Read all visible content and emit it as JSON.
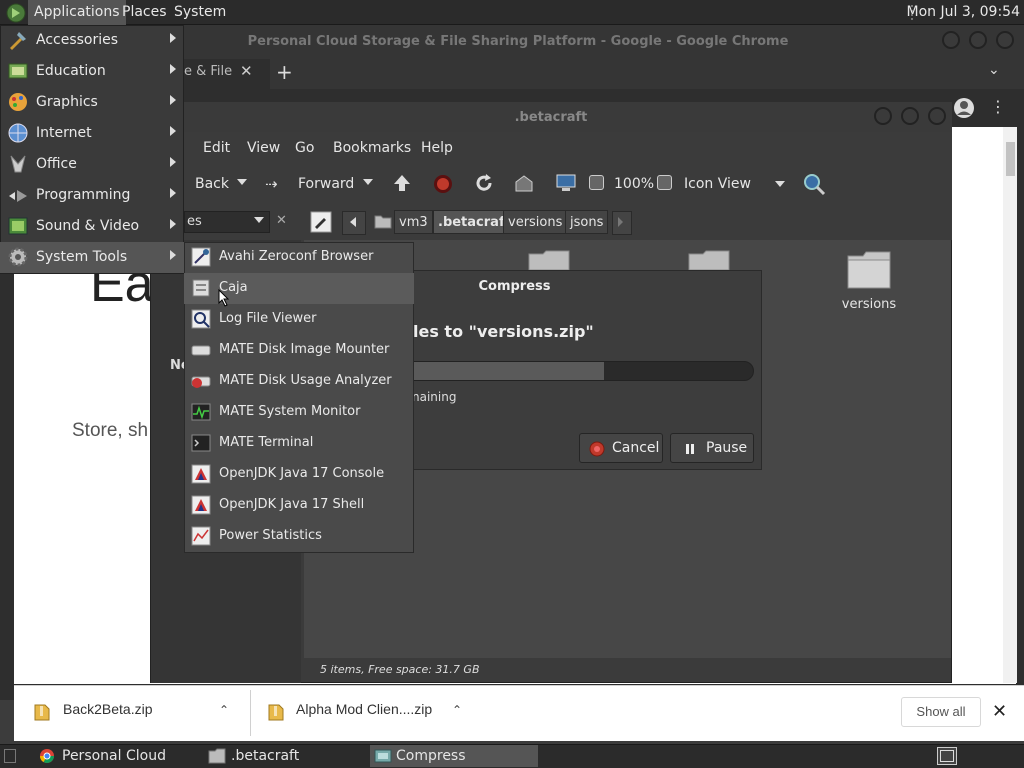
{
  "panel": {
    "menus": [
      "Applications",
      "Places",
      "System"
    ],
    "clock": "Mon Jul 3, 09:54"
  },
  "chrome": {
    "title": "Personal Cloud Storage & File Sharing Platform - Google - Google Chrome",
    "tab_title_fragment": "e & File",
    "page_hero_fragment": "Ea",
    "page_sub_fragment": "Store, sh",
    "downloads": [
      {
        "name": "Back2Beta.zip",
        "icon": "zip-file-icon"
      },
      {
        "name": "Alpha Mod Clien....zip",
        "icon": "zip-file-icon"
      }
    ],
    "show_all_label": "Show all"
  },
  "caja": {
    "title": ".betacraft",
    "menus": [
      "Edit",
      "View",
      "Go",
      "Bookmarks",
      "Help"
    ],
    "toolbar": {
      "back": "Back",
      "forward": "Forward",
      "zoom": "100%",
      "view_mode": "Icon View"
    },
    "sidebar_combo_fragment": "es",
    "sidebar_heading_fragment": "Ne",
    "breadcrumbs": [
      "vm3",
      ".betacraft",
      "versions",
      "jsons"
    ],
    "folders": [
      {
        "name": "",
        "icon": "folder-icon"
      },
      {
        "name": "",
        "icon": "folder-icon"
      },
      {
        "name": "versions",
        "icon": "folder-icon"
      }
    ],
    "status": "5 items, Free space: 31.7 GB"
  },
  "compress": {
    "title": "Compress",
    "heading_fragment": "les to \"versions.zip\"",
    "remaining_fragment": "naining",
    "progress": 0.6,
    "cancel_label": "Cancel",
    "pause_label": "Pause"
  },
  "apps_menu": [
    {
      "label": "Accessories",
      "icon": "accessories-icon"
    },
    {
      "label": "Education",
      "icon": "education-icon"
    },
    {
      "label": "Graphics",
      "icon": "graphics-icon"
    },
    {
      "label": "Internet",
      "icon": "internet-icon"
    },
    {
      "label": "Office",
      "icon": "office-icon"
    },
    {
      "label": "Programming",
      "icon": "programming-icon"
    },
    {
      "label": "Sound & Video",
      "icon": "sound-video-icon"
    },
    {
      "label": "System Tools",
      "icon": "system-tools-icon"
    }
  ],
  "system_tools": [
    {
      "label": "Avahi Zeroconf Browser",
      "icon": "avahi-icon"
    },
    {
      "label": "Caja",
      "icon": "caja-icon"
    },
    {
      "label": "Log File Viewer",
      "icon": "log-viewer-icon"
    },
    {
      "label": "MATE Disk Image Mounter",
      "icon": "disk-image-icon"
    },
    {
      "label": "MATE Disk Usage Analyzer",
      "icon": "disk-usage-icon"
    },
    {
      "label": "MATE System Monitor",
      "icon": "system-monitor-icon"
    },
    {
      "label": "MATE Terminal",
      "icon": "terminal-icon"
    },
    {
      "label": "OpenJDK Java 17 Console",
      "icon": "java-icon"
    },
    {
      "label": "OpenJDK Java 17 Shell",
      "icon": "java-icon"
    },
    {
      "label": "Power Statistics",
      "icon": "power-stats-icon"
    }
  ],
  "taskbar": [
    {
      "label": "Personal Cloud Stor...",
      "icon": "chrome-icon"
    },
    {
      "label": ".betacraft",
      "icon": "folder-icon"
    },
    {
      "label": "Compress",
      "icon": "compress-icon"
    }
  ]
}
